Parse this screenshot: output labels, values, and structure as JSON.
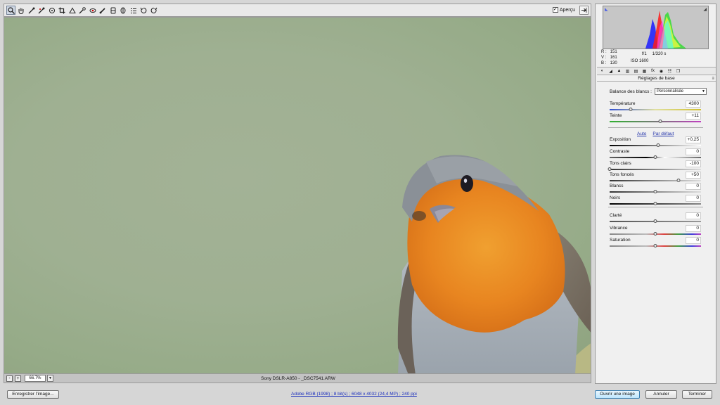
{
  "toolbar": {
    "tools": [
      "zoom-icon",
      "hand-icon",
      "white-balance-icon",
      "color-sampler-icon",
      "target-adjust-icon",
      "crop-icon",
      "straighten-icon",
      "spot-removal-icon",
      "red-eye-icon",
      "adjustment-brush-icon",
      "graduated-filter-icon",
      "radial-filter-icon",
      "preferences-icon",
      "rotate-left-icon",
      "rotate-right-icon"
    ],
    "preview_label": "Aperçu",
    "preview_checked": "✓"
  },
  "status": {
    "zoom_out": "-",
    "zoom_in": "+",
    "zoom_value": "66.7%",
    "file_info": "Sony DSLR-A850  -  _DSC7541.ARW"
  },
  "histogram": {
    "rgb_labels": {
      "r": "R :",
      "g": "V :",
      "b": "B :"
    },
    "rgb_values": {
      "r": "151",
      "g": "161",
      "b": "130"
    },
    "aperture": "f/1",
    "shutter": "1/320 s",
    "iso": "ISO 1600"
  },
  "panel": {
    "section_title": "Réglages de base",
    "white_balance_label": "Balance des blancs :",
    "white_balance_value": "Personnalisée",
    "auto_label": "Auto",
    "default_label": "Par défaut",
    "sliders": [
      {
        "label": "Température",
        "value": "4300",
        "pos": 0.23
      },
      {
        "label": "Teinte",
        "value": "+11",
        "pos": 0.55
      },
      {
        "label": "Exposition",
        "value": "+0,25",
        "pos": 0.53
      },
      {
        "label": "Contraste",
        "value": "0",
        "pos": 0.5
      },
      {
        "label": "Tons clairs",
        "value": "-100",
        "pos": 0.0
      },
      {
        "label": "Tons foncés",
        "value": "+50",
        "pos": 0.75
      },
      {
        "label": "Blancs",
        "value": "0",
        "pos": 0.5
      },
      {
        "label": "Noirs",
        "value": "0",
        "pos": 0.5
      },
      {
        "label": "Clarté",
        "value": "0",
        "pos": 0.5
      },
      {
        "label": "Vibrance",
        "value": "0",
        "pos": 0.5
      },
      {
        "label": "Saturation",
        "value": "0",
        "pos": 0.5
      }
    ]
  },
  "footer": {
    "save_label": "Enregistrer l'image...",
    "workflow_link": "Adobe RGB (1998) ; 8 bit(s) ; 6048 x 4032 (24,4 MP) ; 240 ppi",
    "open_label": "Ouvrir une image",
    "cancel_label": "Annuler",
    "done_label": "Terminer"
  }
}
